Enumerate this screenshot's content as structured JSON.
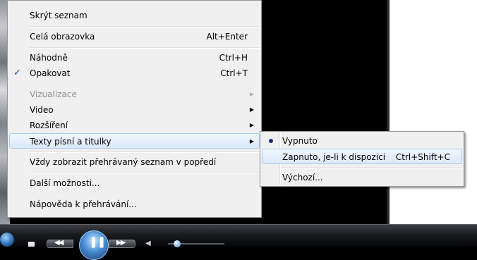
{
  "main_menu": {
    "items": [
      {
        "label": "Skrýt seznam",
        "shortcut": ""
      },
      {
        "label": "Celá obrazovka",
        "shortcut": "Alt+Enter"
      },
      {
        "label": "Náhodně",
        "shortcut": "Ctrl+H"
      },
      {
        "label": "Opakovat",
        "shortcut": "Ctrl+T",
        "checked": true
      },
      {
        "label": "Vizualizace",
        "shortcut": "",
        "disabled": true,
        "submenu": true
      },
      {
        "label": "Video",
        "shortcut": "",
        "submenu": true
      },
      {
        "label": "Rozšíření",
        "shortcut": "",
        "submenu": true
      },
      {
        "label": "Texty písní a titulky",
        "shortcut": "",
        "submenu": true,
        "highlighted": true
      },
      {
        "label": "Vždy zobrazit přehrávaný seznam v popředí",
        "shortcut": ""
      },
      {
        "label": "Další možnosti...",
        "shortcut": ""
      },
      {
        "label": "Nápověda k přehrávání...",
        "shortcut": ""
      }
    ],
    "check_glyph": "✓",
    "arrow_glyph": "▶"
  },
  "sub_menu": {
    "items": [
      {
        "label": "Vypnuto",
        "shortcut": "",
        "selected": true
      },
      {
        "label": "Zapnuto, je-li k dispozici",
        "shortcut": "Ctrl+Shift+C",
        "highlighted": true
      },
      {
        "label": "Výchozí...",
        "shortcut": ""
      }
    ]
  },
  "player_controls": {
    "prev_glyph": "◀◀",
    "play_pause_glyph": "❚❚",
    "next_glyph": "▶▶",
    "mute_glyph": "◀",
    "accent_color": "#4a8fd6",
    "volume_level": 0.1
  }
}
